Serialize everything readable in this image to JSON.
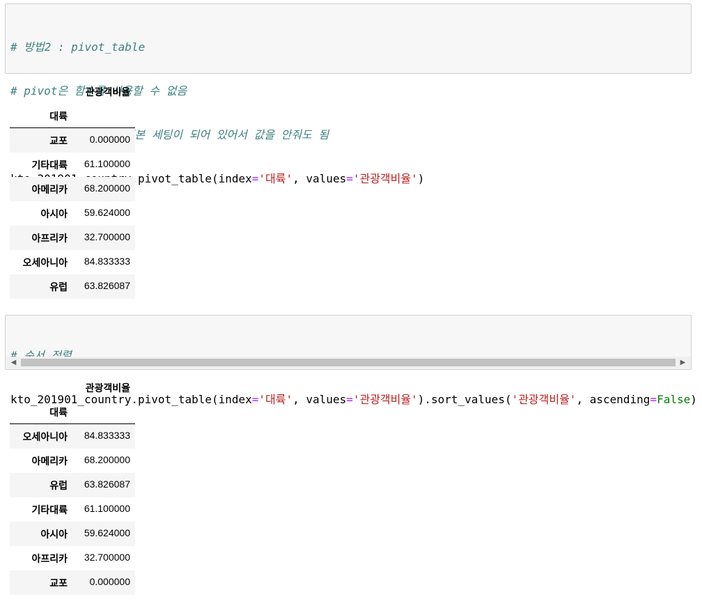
{
  "cell1": {
    "comment_lines": [
      "# 방법2 : pivot_table",
      "# pivot은 함수를 사용할 수 없음",
      "# aggfunc='mean' 기본 세팅이 되어 있어서 값을 안줘도 됨"
    ],
    "code": {
      "prefix": "kto_201901_country.pivot_table(index",
      "eq1": "=",
      "index_str": "'대륙'",
      "mid": ", values",
      "eq2": "=",
      "values_str": "'관광객비율'",
      "suffix": ")"
    }
  },
  "output1": {
    "column_header": "관광객비율",
    "index_name": "대륙",
    "rows": [
      {
        "index": "교포",
        "value": "0.000000"
      },
      {
        "index": "기타대륙",
        "value": "61.100000"
      },
      {
        "index": "아메리카",
        "value": "68.200000"
      },
      {
        "index": "아시아",
        "value": "59.624000"
      },
      {
        "index": "아프리카",
        "value": "32.700000"
      },
      {
        "index": "오세아니아",
        "value": "84.833333"
      },
      {
        "index": "유럽",
        "value": "63.826087"
      }
    ]
  },
  "cell2": {
    "comment_line": "# 순서 정렬",
    "code": {
      "prefix": "kto_201901_country.pivot_table(index",
      "eq1": "=",
      "index_str": "'대륙'",
      "mid1": ", values",
      "eq2": "=",
      "values_str": "'관광객비율'",
      "mid2": ").sort_values(",
      "sort_str": "'관광객비율'",
      "mid3": ", ascending",
      "eq3": "=",
      "false_kw": "False",
      "suffix": ")"
    },
    "scrollbar": {
      "left_icon": "◀",
      "right_icon": "▶"
    }
  },
  "output2": {
    "column_header": "관광객비율",
    "index_name": "대륙",
    "rows": [
      {
        "index": "오세아니아",
        "value": "84.833333"
      },
      {
        "index": "아메리카",
        "value": "68.200000"
      },
      {
        "index": "유럽",
        "value": "63.826087"
      },
      {
        "index": "기타대륙",
        "value": "61.100000"
      },
      {
        "index": "아시아",
        "value": "59.624000"
      },
      {
        "index": "아프리카",
        "value": "32.700000"
      },
      {
        "index": "교포",
        "value": "0.000000"
      }
    ]
  },
  "colors": {
    "comment": "#408080",
    "string": "#ba2121",
    "keyword": "#008000",
    "operator": "#aa22ff",
    "cell_background": "#f7f7f7",
    "cell_border": "#cfcfcf",
    "row_stripe": "#f5f5f5"
  }
}
